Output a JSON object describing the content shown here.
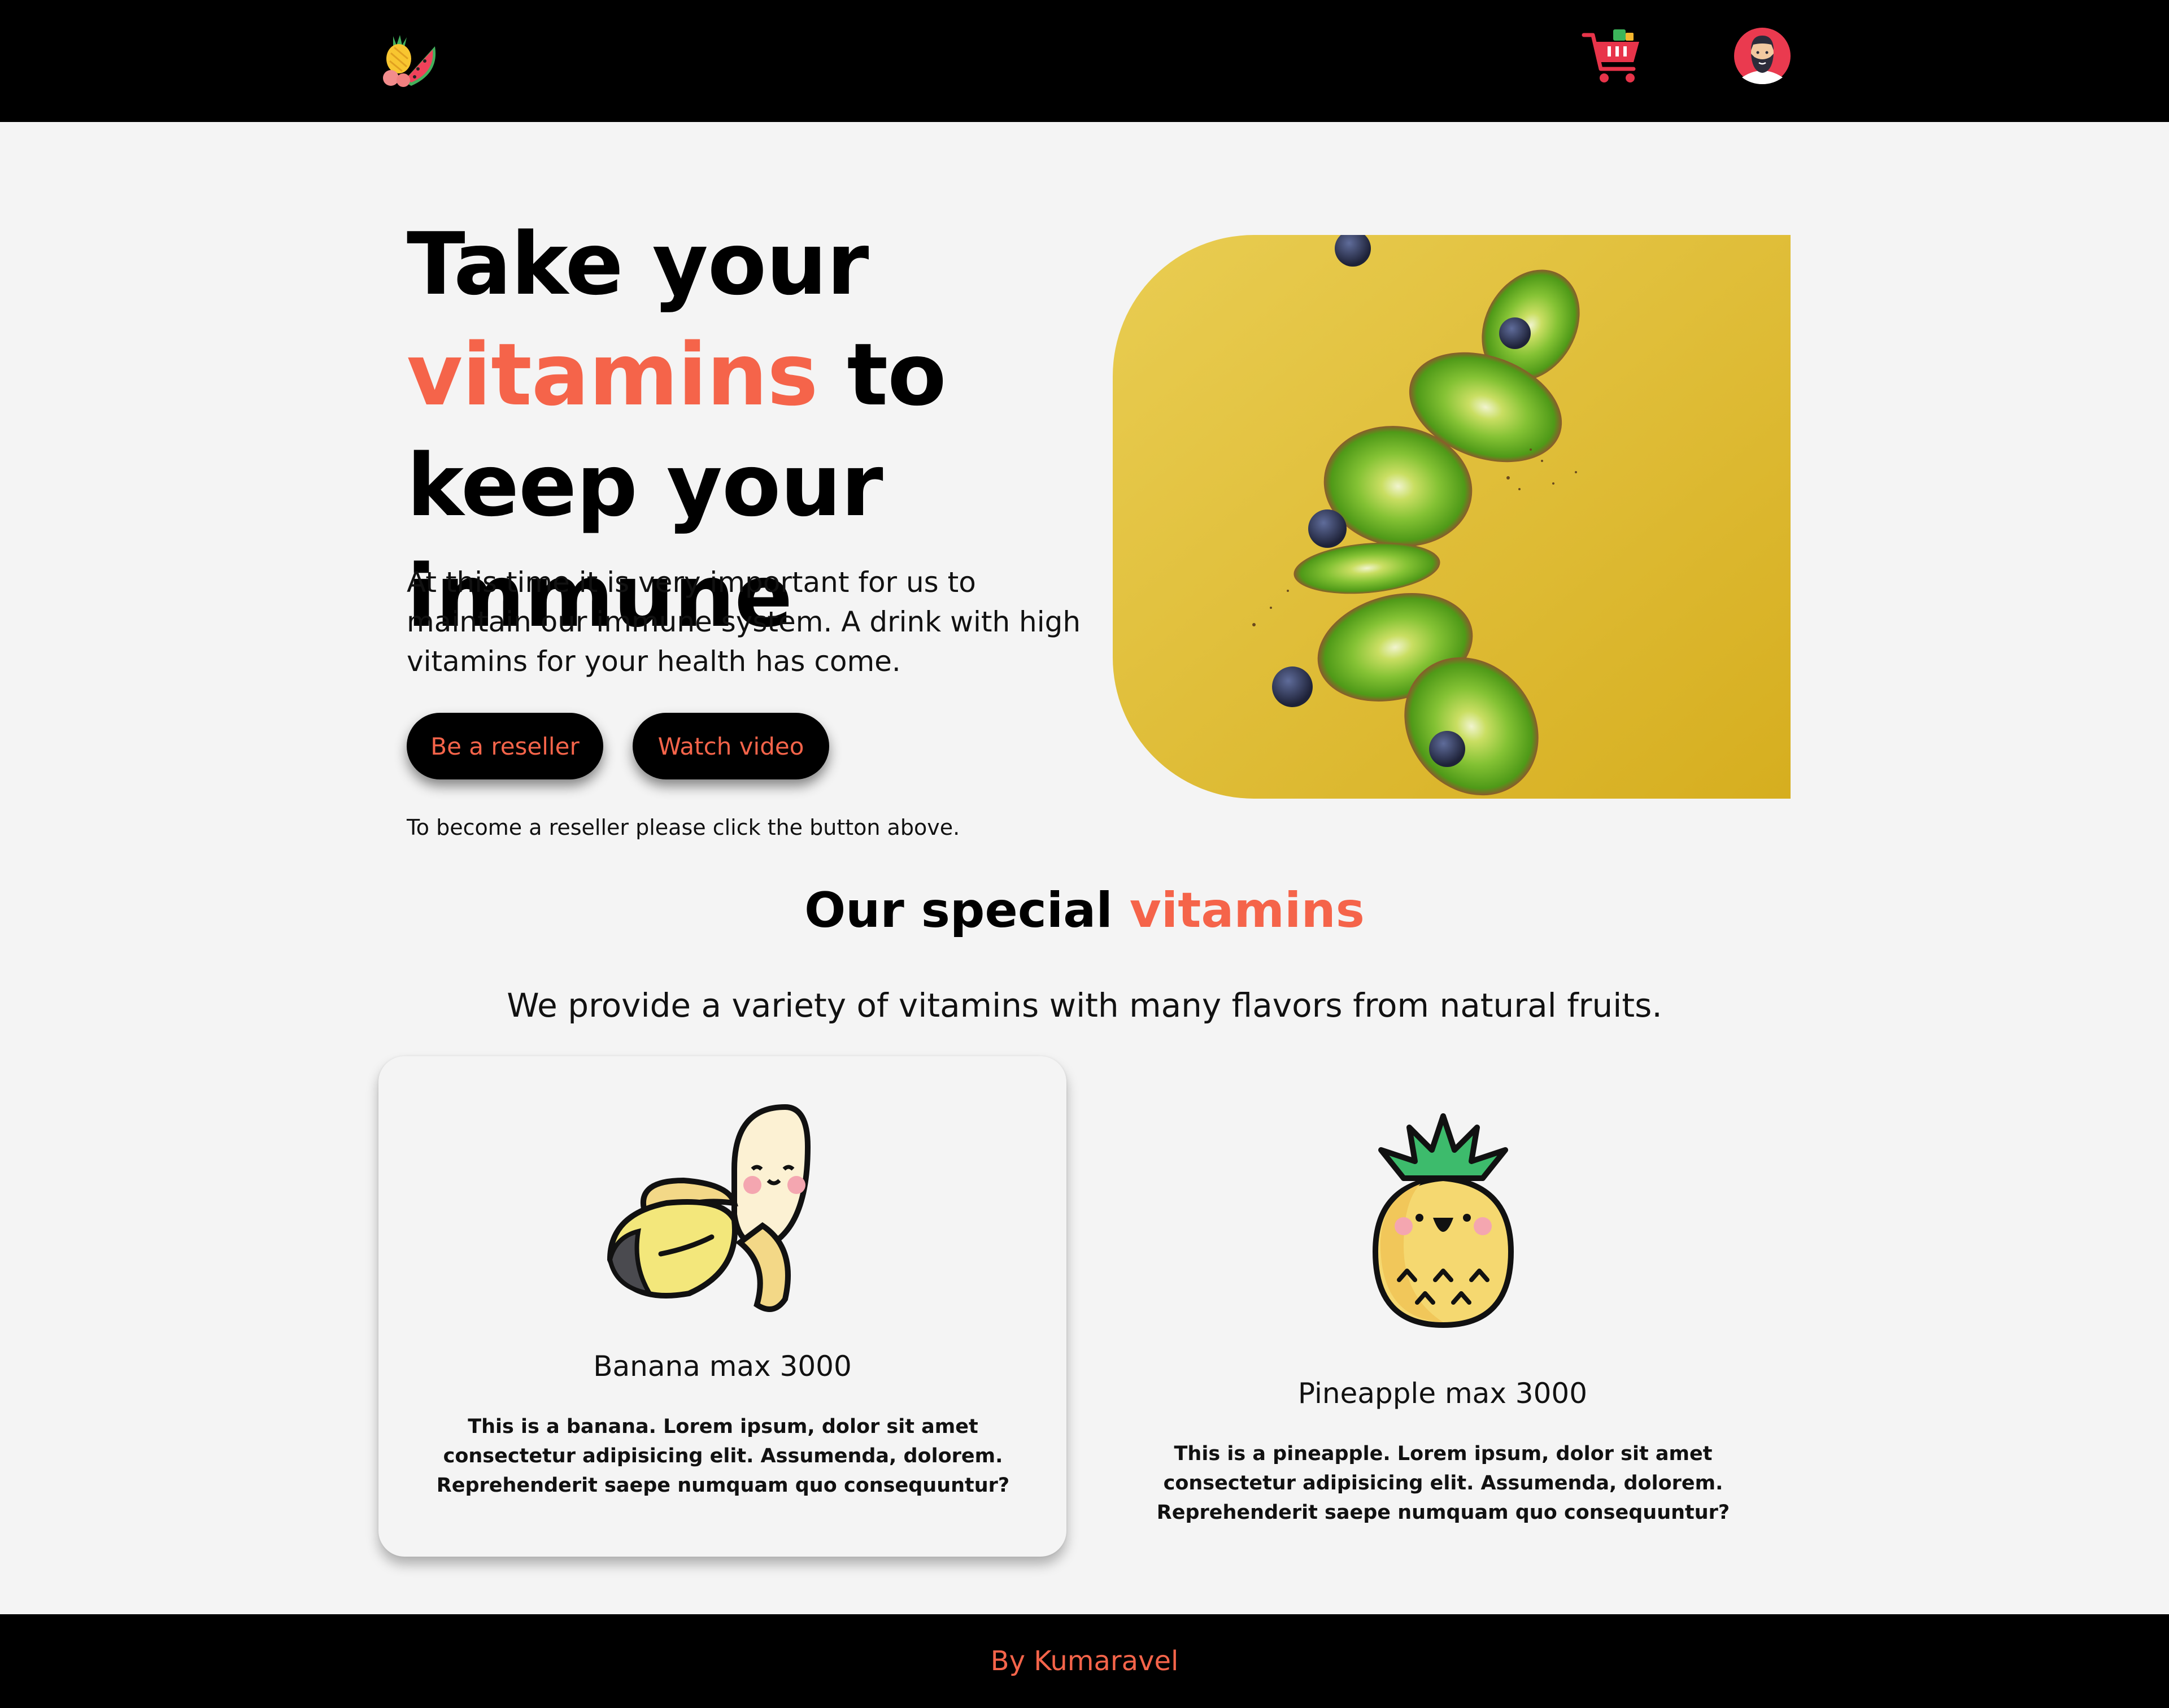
{
  "colors": {
    "accent": "#f5644a",
    "nav_bg": "#000000",
    "page_bg": "#f4f4f4",
    "hero_image_bg": "#e0bd2f"
  },
  "navbar": {
    "logo_icon": "fruit-logo-icon",
    "cart_icon": "shopping-cart-icon",
    "avatar_icon": "bearded-man-avatar-icon"
  },
  "hero": {
    "title_part1": "Take your",
    "title_accent": "vitamins",
    "title_part2": " to keep your immune",
    "description": "At this time it is very important for us to maintain our immune system. A drink with high vitamins for your health has come.",
    "button_reseller": "Be a reseller",
    "button_video": "Watch video",
    "note": "To become a reseller please click the button above.",
    "image": "kiwi-slices-blueberries-photo"
  },
  "vitamins": {
    "title_part1": "Our special ",
    "title_accent": "vitamins",
    "subtitle": "We provide a variety of vitamins with many flavors from natural fruits.",
    "cards": [
      {
        "name": "Banana max 3000",
        "description": "This is a banana. Lorem ipsum, dolor sit amet consectetur adipisicing elit. Assumenda, dolorem. Reprehenderit saepe numquam quo consequuntur?",
        "icon": "banana-icon"
      },
      {
        "name": "Pineapple max 3000",
        "description": "This is a pineapple. Lorem ipsum, dolor sit amet consectetur adipisicing elit. Assumenda, dolorem. Reprehenderit saepe numquam quo consequuntur?",
        "icon": "pineapple-icon"
      }
    ]
  },
  "footer": {
    "text": "By Kumaravel"
  }
}
